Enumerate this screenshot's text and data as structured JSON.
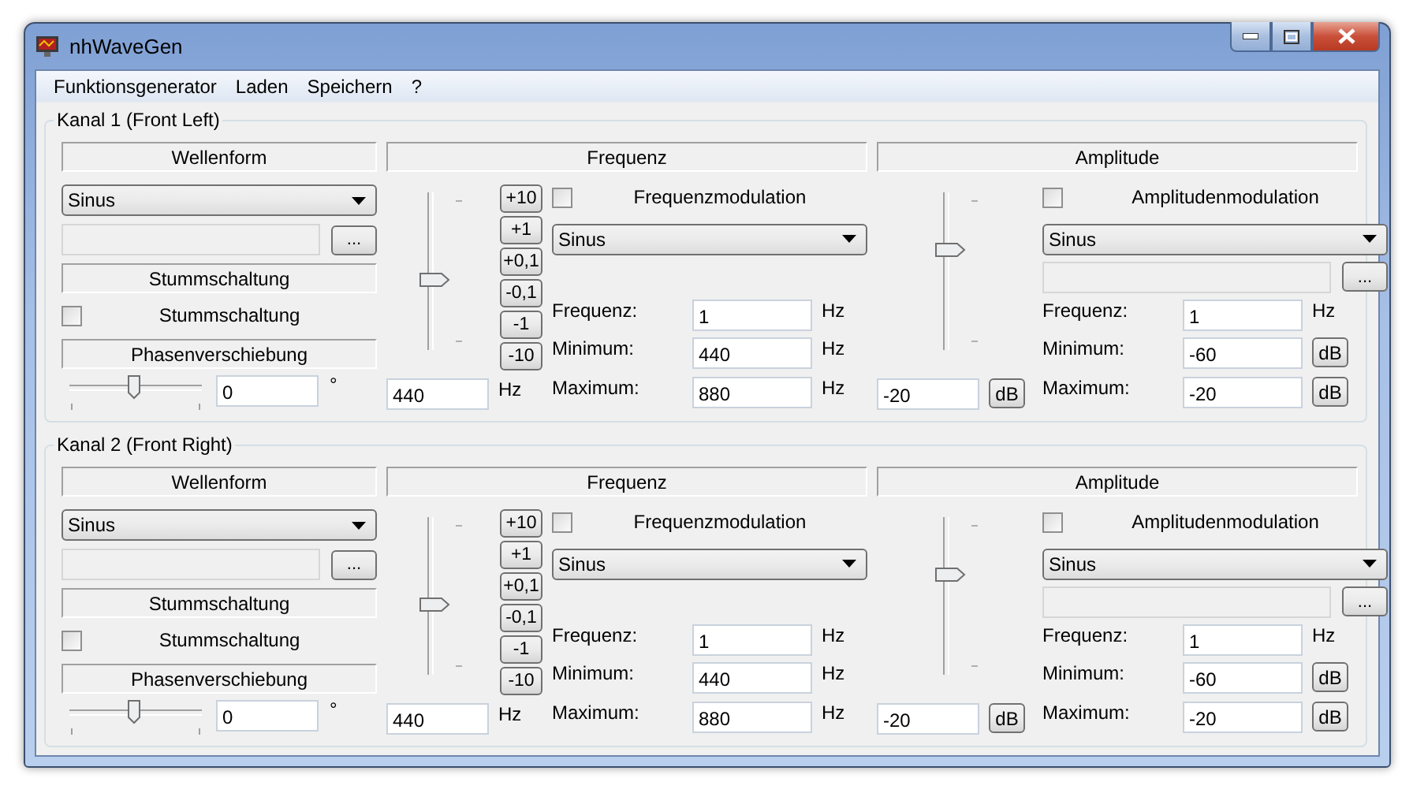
{
  "window": {
    "title": "nhWaveGen"
  },
  "menu": [
    "Funktionsgenerator",
    "Laden",
    "Speichern",
    "?"
  ],
  "channels": [
    {
      "title": "Kanal 1 (Front Left)",
      "waveform": {
        "header": "Wellenform",
        "shape": "Sinus",
        "browse": "...",
        "mute_header": "Stummschaltung",
        "mute": {
          "label": "Stummschaltung",
          "checked": false
        },
        "phase_header": "Phasenverschiebung",
        "phase": {
          "level": 0.5,
          "value": "0",
          "unit": "°"
        }
      },
      "frequency": {
        "header": "Frequenz",
        "slider": {
          "level": 0.44
        },
        "steps": [
          "+10",
          "+1",
          "+0,1",
          "-0,1",
          "-1",
          "-10"
        ],
        "input": {
          "value": "440",
          "unit": "Hz",
          "kind": "label"
        },
        "modulation": {
          "label": "Frequenzmodulation",
          "checked": false,
          "shape": "Sinus",
          "rows": [
            {
              "label": "Frequenz:",
              "value": "1",
              "unit": "Hz",
              "kind": "label"
            },
            {
              "label": "Minimum:",
              "value": "440",
              "unit": "Hz",
              "kind": "label"
            },
            {
              "label": "Maximum:",
              "value": "880",
              "unit": "Hz",
              "kind": "label"
            }
          ]
        }
      },
      "amplitude": {
        "header": "Amplitude",
        "slider": {
          "level": 0.65
        },
        "input": {
          "value": "-20",
          "unit": "dB",
          "kind": "button"
        },
        "modulation": {
          "label": "Amplitudenmodulation",
          "checked": false,
          "shape": "Sinus",
          "browse": "...",
          "rows": [
            {
              "label": "Frequenz:",
              "value": "1",
              "unit": "Hz",
              "kind": "label"
            },
            {
              "label": "Minimum:",
              "value": "-60",
              "unit": "dB",
              "kind": "button"
            },
            {
              "label": "Maximum:",
              "value": "-20",
              "unit": "dB",
              "kind": "button"
            }
          ]
        }
      }
    },
    {
      "title": "Kanal 2 (Front Right)",
      "waveform": {
        "header": "Wellenform",
        "shape": "Sinus",
        "browse": "...",
        "mute_header": "Stummschaltung",
        "mute": {
          "label": "Stummschaltung",
          "checked": false
        },
        "phase_header": "Phasenverschiebung",
        "phase": {
          "level": 0.5,
          "value": "0",
          "unit": "°"
        }
      },
      "frequency": {
        "header": "Frequenz",
        "slider": {
          "level": 0.44
        },
        "steps": [
          "+10",
          "+1",
          "+0,1",
          "-0,1",
          "-1",
          "-10"
        ],
        "input": {
          "value": "440",
          "unit": "Hz",
          "kind": "label"
        },
        "modulation": {
          "label": "Frequenzmodulation",
          "checked": false,
          "shape": "Sinus",
          "rows": [
            {
              "label": "Frequenz:",
              "value": "1",
              "unit": "Hz",
              "kind": "label"
            },
            {
              "label": "Minimum:",
              "value": "440",
              "unit": "Hz",
              "kind": "label"
            },
            {
              "label": "Maximum:",
              "value": "880",
              "unit": "Hz",
              "kind": "label"
            }
          ]
        }
      },
      "amplitude": {
        "header": "Amplitude",
        "slider": {
          "level": 0.65
        },
        "input": {
          "value": "-20",
          "unit": "dB",
          "kind": "button"
        },
        "modulation": {
          "label": "Amplitudenmodulation",
          "checked": false,
          "shape": "Sinus",
          "browse": "...",
          "rows": [
            {
              "label": "Frequenz:",
              "value": "1",
              "unit": "Hz",
              "kind": "label"
            },
            {
              "label": "Minimum:",
              "value": "-60",
              "unit": "dB",
              "kind": "button"
            },
            {
              "label": "Maximum:",
              "value": "-20",
              "unit": "dB",
              "kind": "button"
            }
          ]
        }
      }
    }
  ]
}
